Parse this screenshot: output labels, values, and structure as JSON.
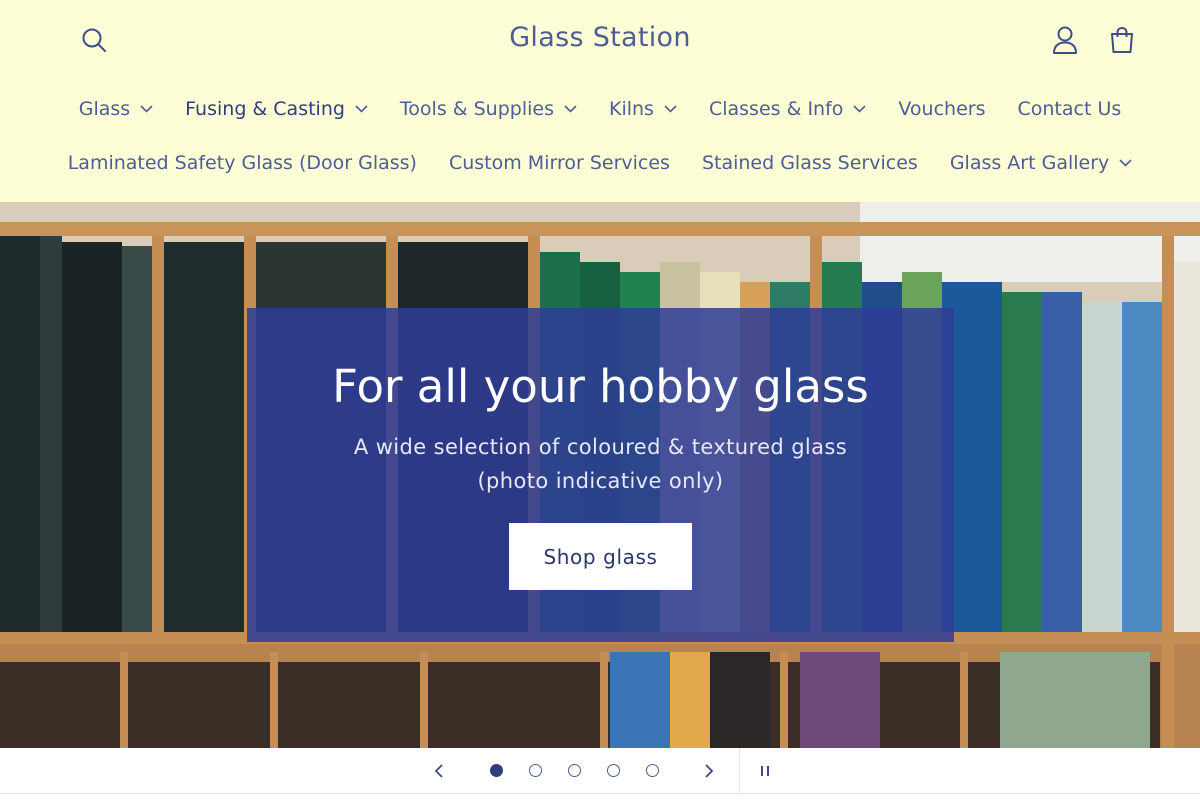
{
  "header": {
    "logo": "Glass Station",
    "icons": {
      "search": "search-icon",
      "account": "account-icon",
      "cart": "cart-icon"
    }
  },
  "nav": {
    "row1": [
      {
        "label": "Glass",
        "has_dropdown": true
      },
      {
        "label": "Fusing & Casting",
        "has_dropdown": true,
        "active": true
      },
      {
        "label": "Tools & Supplies",
        "has_dropdown": true
      },
      {
        "label": "Kilns",
        "has_dropdown": true
      },
      {
        "label": "Classes & Info",
        "has_dropdown": true
      },
      {
        "label": "Vouchers",
        "has_dropdown": false
      },
      {
        "label": "Contact Us",
        "has_dropdown": false
      }
    ],
    "row2": [
      {
        "label": "Laminated Safety Glass (Door Glass)",
        "has_dropdown": false
      },
      {
        "label": "Custom Mirror Services",
        "has_dropdown": false
      },
      {
        "label": "Stained Glass Services",
        "has_dropdown": false
      },
      {
        "label": "Glass Art Gallery",
        "has_dropdown": true
      }
    ]
  },
  "hero": {
    "title": "For all your hobby glass",
    "subtitle": "A wide selection of coloured & textured glass (photo indicative only)",
    "button_label": "Shop glass"
  },
  "slider": {
    "slide_count": 5,
    "active_slide": 1,
    "icons": {
      "prev": "chevron-left-icon",
      "next": "chevron-right-icon",
      "pause": "pause-icon"
    }
  },
  "colors": {
    "header_bg": "#fefed6",
    "nav_text": "#4d5d97",
    "hero_overlay": "#2f3c96",
    "button_bg": "#ffffff"
  }
}
